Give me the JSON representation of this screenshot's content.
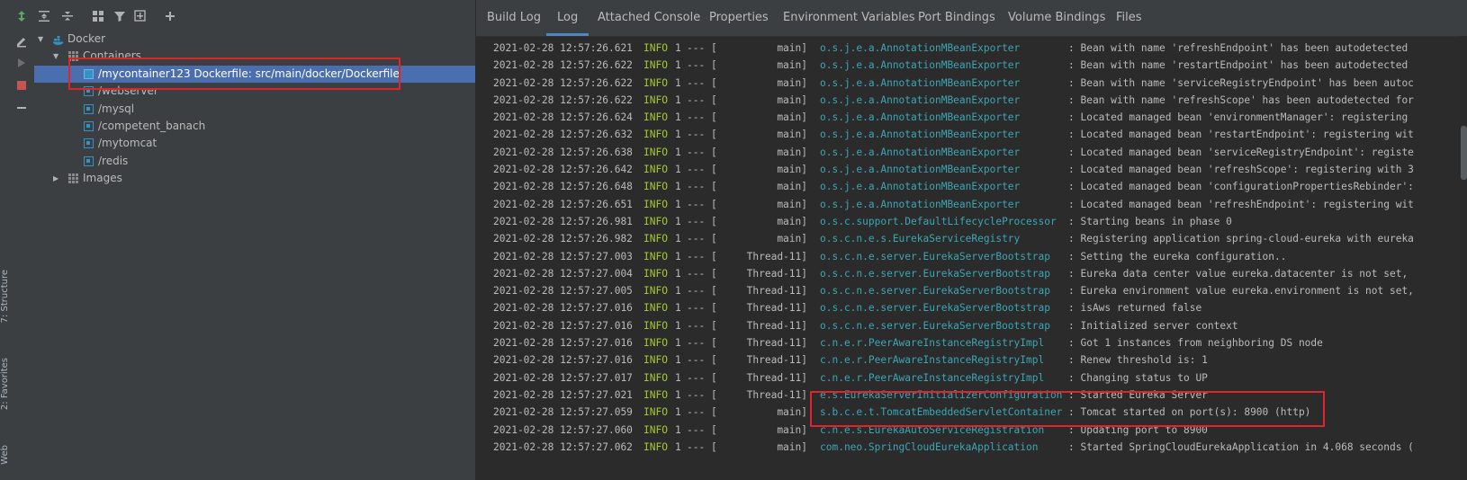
{
  "side_tabs": {
    "structure": "7: Structure",
    "favorites": "2: Favorites",
    "web": "Web"
  },
  "tree": {
    "root": "Docker",
    "containers_label": "Containers",
    "containers": [
      {
        "name": "/mycontainer123 Dockerfile: src/main/docker/Dockerfile",
        "selected": true
      },
      {
        "name": "/webserver"
      },
      {
        "name": "/mysql"
      },
      {
        "name": "/competent_banach"
      },
      {
        "name": "/mytomcat"
      },
      {
        "name": "/redis"
      }
    ],
    "images_label": "Images"
  },
  "tabs": [
    "Build Log",
    "Log",
    "Attached Console",
    "Properties",
    "Environment Variables",
    "Port Bindings",
    "Volume Bindings",
    "Files"
  ],
  "active_tab": "Log",
  "log": [
    {
      "ts": "2021-02-28 12:57:26.621",
      "lvl": "INFO",
      "pid": "1",
      "sep": "---",
      "thr": "main]",
      "cls": "o.s.j.e.a.AnnotationMBeanExporter",
      "msg": ": Bean with name 'refreshEndpoint' has been autodetected"
    },
    {
      "ts": "2021-02-28 12:57:26.622",
      "lvl": "INFO",
      "pid": "1",
      "sep": "---",
      "thr": "main]",
      "cls": "o.s.j.e.a.AnnotationMBeanExporter",
      "msg": ": Bean with name 'restartEndpoint' has been autodetected"
    },
    {
      "ts": "2021-02-28 12:57:26.622",
      "lvl": "INFO",
      "pid": "1",
      "sep": "---",
      "thr": "main]",
      "cls": "o.s.j.e.a.AnnotationMBeanExporter",
      "msg": ": Bean with name 'serviceRegistryEndpoint' has been autoc"
    },
    {
      "ts": "2021-02-28 12:57:26.622",
      "lvl": "INFO",
      "pid": "1",
      "sep": "---",
      "thr": "main]",
      "cls": "o.s.j.e.a.AnnotationMBeanExporter",
      "msg": ": Bean with name 'refreshScope' has been autodetected for"
    },
    {
      "ts": "2021-02-28 12:57:26.624",
      "lvl": "INFO",
      "pid": "1",
      "sep": "---",
      "thr": "main]",
      "cls": "o.s.j.e.a.AnnotationMBeanExporter",
      "msg": ": Located managed bean 'environmentManager': registering"
    },
    {
      "ts": "2021-02-28 12:57:26.632",
      "lvl": "INFO",
      "pid": "1",
      "sep": "---",
      "thr": "main]",
      "cls": "o.s.j.e.a.AnnotationMBeanExporter",
      "msg": ": Located managed bean 'restartEndpoint': registering wit"
    },
    {
      "ts": "2021-02-28 12:57:26.638",
      "lvl": "INFO",
      "pid": "1",
      "sep": "---",
      "thr": "main]",
      "cls": "o.s.j.e.a.AnnotationMBeanExporter",
      "msg": ": Located managed bean 'serviceRegistryEndpoint': registe"
    },
    {
      "ts": "2021-02-28 12:57:26.642",
      "lvl": "INFO",
      "pid": "1",
      "sep": "---",
      "thr": "main]",
      "cls": "o.s.j.e.a.AnnotationMBeanExporter",
      "msg": ": Located managed bean 'refreshScope': registering with 3"
    },
    {
      "ts": "2021-02-28 12:57:26.648",
      "lvl": "INFO",
      "pid": "1",
      "sep": "---",
      "thr": "main]",
      "cls": "o.s.j.e.a.AnnotationMBeanExporter",
      "msg": ": Located managed bean 'configurationPropertiesRebinder':"
    },
    {
      "ts": "2021-02-28 12:57:26.651",
      "lvl": "INFO",
      "pid": "1",
      "sep": "---",
      "thr": "main]",
      "cls": "o.s.j.e.a.AnnotationMBeanExporter",
      "msg": ": Located managed bean 'refreshEndpoint': registering wit"
    },
    {
      "ts": "2021-02-28 12:57:26.981",
      "lvl": "INFO",
      "pid": "1",
      "sep": "---",
      "thr": "main]",
      "cls": "o.s.c.support.DefaultLifecycleProcessor",
      "msg": ": Starting beans in phase 0"
    },
    {
      "ts": "2021-02-28 12:57:26.982",
      "lvl": "INFO",
      "pid": "1",
      "sep": "---",
      "thr": "main]",
      "cls": "o.s.c.n.e.s.EurekaServiceRegistry",
      "msg": ": Registering application spring-cloud-eureka with eureka"
    },
    {
      "ts": "2021-02-28 12:57:27.003",
      "lvl": "INFO",
      "pid": "1",
      "sep": "---",
      "thr": "Thread-11]",
      "cls": "o.s.c.n.e.server.EurekaServerBootstrap",
      "msg": ": Setting the eureka configuration.."
    },
    {
      "ts": "2021-02-28 12:57:27.004",
      "lvl": "INFO",
      "pid": "1",
      "sep": "---",
      "thr": "Thread-11]",
      "cls": "o.s.c.n.e.server.EurekaServerBootstrap",
      "msg": ": Eureka data center value eureka.datacenter is not set,"
    },
    {
      "ts": "2021-02-28 12:57:27.005",
      "lvl": "INFO",
      "pid": "1",
      "sep": "---",
      "thr": "Thread-11]",
      "cls": "o.s.c.n.e.server.EurekaServerBootstrap",
      "msg": ": Eureka environment value eureka.environment is not set,"
    },
    {
      "ts": "2021-02-28 12:57:27.016",
      "lvl": "INFO",
      "pid": "1",
      "sep": "---",
      "thr": "Thread-11]",
      "cls": "o.s.c.n.e.server.EurekaServerBootstrap",
      "msg": ": isAws returned false"
    },
    {
      "ts": "2021-02-28 12:57:27.016",
      "lvl": "INFO",
      "pid": "1",
      "sep": "---",
      "thr": "Thread-11]",
      "cls": "o.s.c.n.e.server.EurekaServerBootstrap",
      "msg": ": Initialized server context"
    },
    {
      "ts": "2021-02-28 12:57:27.016",
      "lvl": "INFO",
      "pid": "1",
      "sep": "---",
      "thr": "Thread-11]",
      "cls": "c.n.e.r.PeerAwareInstanceRegistryImpl",
      "msg": ": Got 1 instances from neighboring DS node"
    },
    {
      "ts": "2021-02-28 12:57:27.016",
      "lvl": "INFO",
      "pid": "1",
      "sep": "---",
      "thr": "Thread-11]",
      "cls": "c.n.e.r.PeerAwareInstanceRegistryImpl",
      "msg": ": Renew threshold is: 1"
    },
    {
      "ts": "2021-02-28 12:57:27.017",
      "lvl": "INFO",
      "pid": "1",
      "sep": "---",
      "thr": "Thread-11]",
      "cls": "c.n.e.r.PeerAwareInstanceRegistryImpl",
      "msg": ": Changing status to UP"
    },
    {
      "ts": "2021-02-28 12:57:27.021",
      "lvl": "INFO",
      "pid": "1",
      "sep": "---",
      "thr": "Thread-11]",
      "cls": "e.s.EurekaServerInitializerConfiguration",
      "msg": ": Started Eureka Server"
    },
    {
      "ts": "2021-02-28 12:57:27.059",
      "lvl": "INFO",
      "pid": "1",
      "sep": "---",
      "thr": "main]",
      "cls": "s.b.c.e.t.TomcatEmbeddedServletContainer",
      "msg": ": Tomcat started on port(s): 8900 (http)"
    },
    {
      "ts": "2021-02-28 12:57:27.060",
      "lvl": "INFO",
      "pid": "1",
      "sep": "---",
      "thr": "main]",
      "cls": "c.n.e.s.EurekaAutoServiceRegistration",
      "msg": ": Updating port to 8900"
    },
    {
      "ts": "2021-02-28 12:57:27.062",
      "lvl": "INFO",
      "pid": "1",
      "sep": "---",
      "thr": "main]",
      "cls": "com.neo.SpringCloudEurekaApplication",
      "msg": ": Started SpringCloudEurekaApplication in 4.068 seconds ("
    }
  ],
  "colors": {
    "accent": "#4a88c7",
    "selection": "#4b6eaf",
    "highlight_box": "#e0242b",
    "info": "#a6c834",
    "logger": "#3ca6b5"
  }
}
